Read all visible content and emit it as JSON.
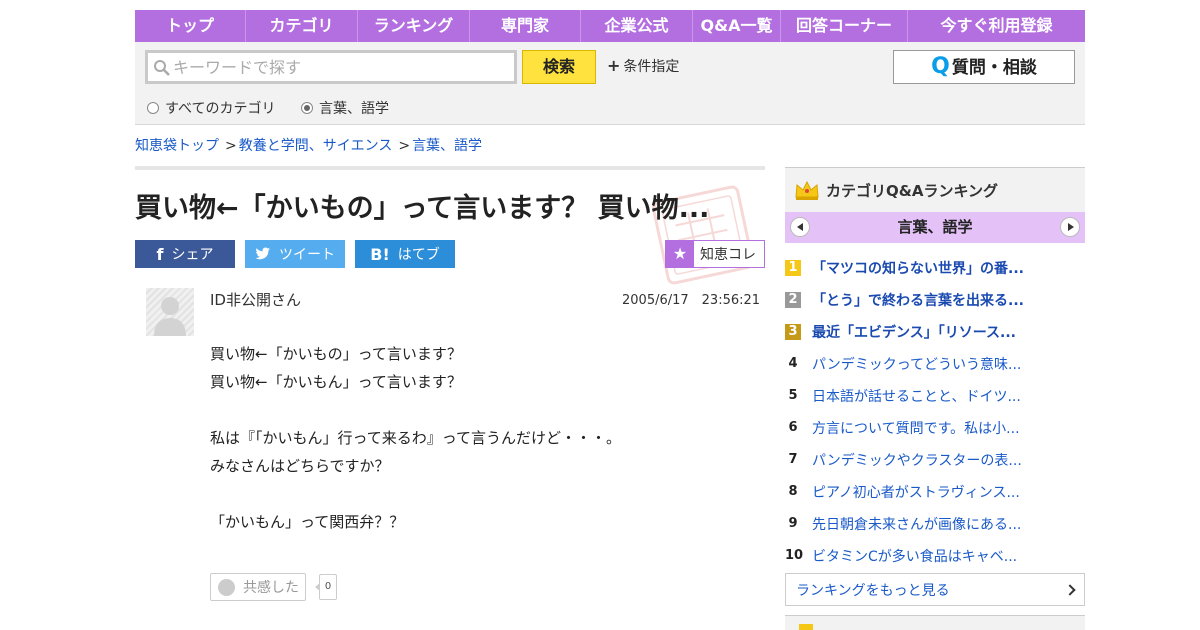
{
  "nav": {
    "items": [
      "トップ",
      "カテゴリ",
      "ランキング",
      "専門家",
      "企業公式",
      "Q&A一覧",
      "回答コーナー",
      "今すぐ利用登録"
    ]
  },
  "search": {
    "placeholder": "キーワードで探す",
    "button_label": "検索",
    "condition_label": "条件指定",
    "ask_label": "質問・相談",
    "scope_all": "すべてのカテゴリ",
    "scope_current": "言葉、語学"
  },
  "breadcrumb": [
    "知恵袋トップ",
    "教養と学問、サイエンス",
    "言葉、語学"
  ],
  "question": {
    "title": "買い物←「かいもの」って言います？ 買い物...",
    "share_fb": "シェア",
    "share_tw": "ツイート",
    "share_hb": "はてブ",
    "collect_label": "知恵コレ",
    "user": "ID非公開さん",
    "date": "2005/6/17　23:56:21",
    "body": [
      "買い物←「かいもの」って言います？",
      "買い物←「かいもん」って言います？",
      "",
      "私は『「かいもん」行って来るわ』って言うんだけど・・・。",
      "みなさんはどちらですか？",
      "",
      "「かいもん」って関西弁？？"
    ],
    "empathy_label": "共感した",
    "empathy_count": "0"
  },
  "ranking": {
    "title": "カテゴリQ&Aランキング",
    "category": "言葉、語学",
    "items": [
      {
        "rank": "1",
        "text": "「マツコの知らない世界」の番..."
      },
      {
        "rank": "2",
        "text": "「とう」で終わる言葉を出来る..."
      },
      {
        "rank": "3",
        "text": "最近「エビデンス」「リソース..."
      },
      {
        "rank": "4",
        "text": "パンデミックってどういう意味..."
      },
      {
        "rank": "5",
        "text": "日本語が話せることと、ドイツ..."
      },
      {
        "rank": "6",
        "text": "方言について質問です。私は小..."
      },
      {
        "rank": "7",
        "text": "パンデミックやクラスターの表..."
      },
      {
        "rank": "8",
        "text": "ピアノ初心者がストラヴィンス..."
      },
      {
        "rank": "9",
        "text": "先日朝倉未来さんが画像にある..."
      },
      {
        "rank": "10",
        "text": "ビタミンCが多い食品はキャベ..."
      }
    ],
    "more_label": "ランキングをもっと見る"
  },
  "colors": {
    "nav_purple": "#b36ee0",
    "category_band": "#e4c2f8",
    "search_yellow": "#ffe23d",
    "link_blue": "#1a5ac8"
  },
  "icons": [
    "search-icon",
    "plus-icon",
    "q-icon",
    "facebook-icon",
    "twitter-icon",
    "hatena-icon",
    "star-icon",
    "crown-icon",
    "chevron-left-icon",
    "chevron-right-icon",
    "smiley-icon"
  ]
}
